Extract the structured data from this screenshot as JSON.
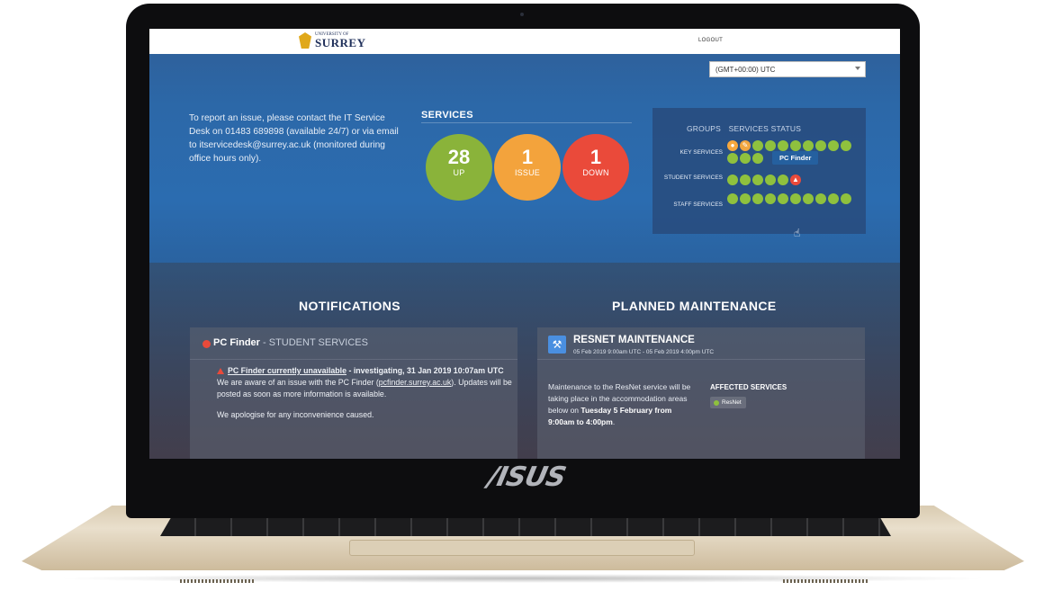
{
  "header": {
    "logo_small": "UNIVERSITY OF",
    "logo_big": "SURREY",
    "logout_label": "LOGOUT",
    "timezone_value": "(GMT+00:00) UTC"
  },
  "intro": {
    "report_text": "To report an issue, please contact the IT Service Desk on 01483 689898 (available 24/7) or via email to itservicedesk@surrey.ac.uk (monitored during office hours only)."
  },
  "services": {
    "title": "SERVICES",
    "up": {
      "count": "28",
      "label": "UP",
      "color": "#8ab33a"
    },
    "issue": {
      "count": "1",
      "label": "ISSUE",
      "color": "#f3a33c"
    },
    "down": {
      "count": "1",
      "label": "DOWN",
      "color": "#ea4a3a"
    }
  },
  "status_grid": {
    "header_groups": "GROUPS",
    "header_services": "SERVICES STATUS",
    "rows": [
      {
        "label": "KEY SERVICES",
        "dots": [
          "issue-pin",
          "wrench",
          "up",
          "up",
          "up",
          "up",
          "up",
          "up",
          "up",
          "up",
          "up",
          "up",
          "up"
        ]
      },
      {
        "label": "STUDENT SERVICES",
        "dots": [
          "up",
          "up",
          "up",
          "up",
          "up",
          "down"
        ]
      },
      {
        "label": "STAFF SERVICES",
        "dots": [
          "up",
          "up",
          "up",
          "up",
          "up",
          "up",
          "up",
          "up",
          "up",
          "up"
        ]
      }
    ],
    "tooltip": "PC Finder"
  },
  "notifications": {
    "title": "NOTIFICATIONS",
    "item": {
      "service": "PC Finder",
      "group": " - STUDENT SERVICES",
      "headline": "PC Finder currently unavailable",
      "headline_status": " - investigating, 31 Jan 2019 10:07am UTC",
      "body_1a": "We are aware of an issue with the PC Finder (",
      "body_link": "pcfinder.surrey.ac.uk",
      "body_1b": "). Updates will be posted as soon as more information is available.",
      "body_2": "We apologise for any inconvenience caused."
    }
  },
  "maintenance": {
    "title": "PLANNED MAINTENANCE",
    "item": {
      "name": "RESNET MAINTENANCE",
      "window": "05 Feb 2019 9:00am UTC - 05 Feb 2019 4:00pm UTC",
      "body": "Maintenance to the ResNet service will be taking place in the accommodation areas below on ",
      "body_bold": "Tuesday 5 February from 9:00am to 4:00pm",
      "body_end": ".",
      "affected_label": "AFFECTED SERVICES",
      "affected_service": "ResNet"
    }
  },
  "device": {
    "brand": "/ISUS"
  }
}
